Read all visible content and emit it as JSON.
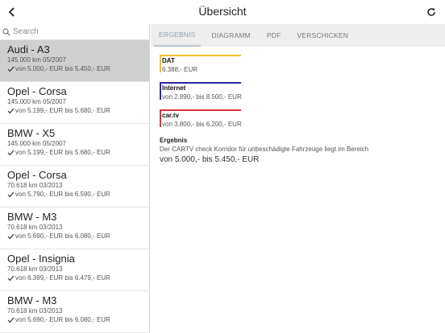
{
  "header": {
    "title": "Übersicht",
    "back_icon": "chevron-left-icon",
    "refresh_icon": "refresh-icon"
  },
  "search": {
    "placeholder": "Search",
    "icon": "search-icon"
  },
  "cars": [
    {
      "name": "Audi - A3",
      "km": "145.000 km 05/2007",
      "range": "von 5.000,- EUR bis 5.450,- EUR",
      "selected": true
    },
    {
      "name": "Opel - Corsa",
      "km": "145.000 km 05/2007",
      "range": "von 5.199,- EUR bis 5.680,- EUR",
      "selected": false
    },
    {
      "name": "BMW - X5",
      "km": "145.000 km 05/2007",
      "range": "von 5.199,- EUR bis 5.680,- EUR",
      "selected": false
    },
    {
      "name": "Opel - Corsa",
      "km": "70.618 km 03/2013",
      "range": "von 5.790,- EUR bis 6.590,- EUR",
      "selected": false
    },
    {
      "name": "BMW - M3",
      "km": "70.618 km 03/2013",
      "range": "von 5.690,- EUR bis 6.080,- EUR",
      "selected": false
    },
    {
      "name": "Opel - Insignia",
      "km": "70.618 km 03/2013",
      "range": "von 6.399,- EUR bis 6.479,- EUR",
      "selected": false
    },
    {
      "name": "BMW - M3",
      "km": "70.618 km 03/2013",
      "range": "von 5.690,- EUR bis 6.080,- EUR",
      "selected": false
    }
  ],
  "tabs": [
    {
      "label": "ERGEBNIS",
      "active": true
    },
    {
      "label": "DIAGRAMM",
      "active": false
    },
    {
      "label": "PDF",
      "active": false
    },
    {
      "label": "VERSCHICKEN",
      "active": false
    }
  ],
  "sources": [
    {
      "name": "DAT",
      "value": "6.388,- EUR",
      "color": "#f2c029"
    },
    {
      "name": "Internet",
      "value": "von 2.890,- bis 8.500,- EUR",
      "color": "#2a2d9c"
    },
    {
      "name": "car.tv",
      "value": "von 3.800,- bis 6.200,- EUR",
      "color": "#d9303a"
    }
  ],
  "result": {
    "title": "Ergebnis",
    "description": "Der CARTV check Korridor für unbeschädigte Fahrzeuge liegt im Bereich",
    "range": "von 5.000,- bis 5.450,- EUR"
  }
}
